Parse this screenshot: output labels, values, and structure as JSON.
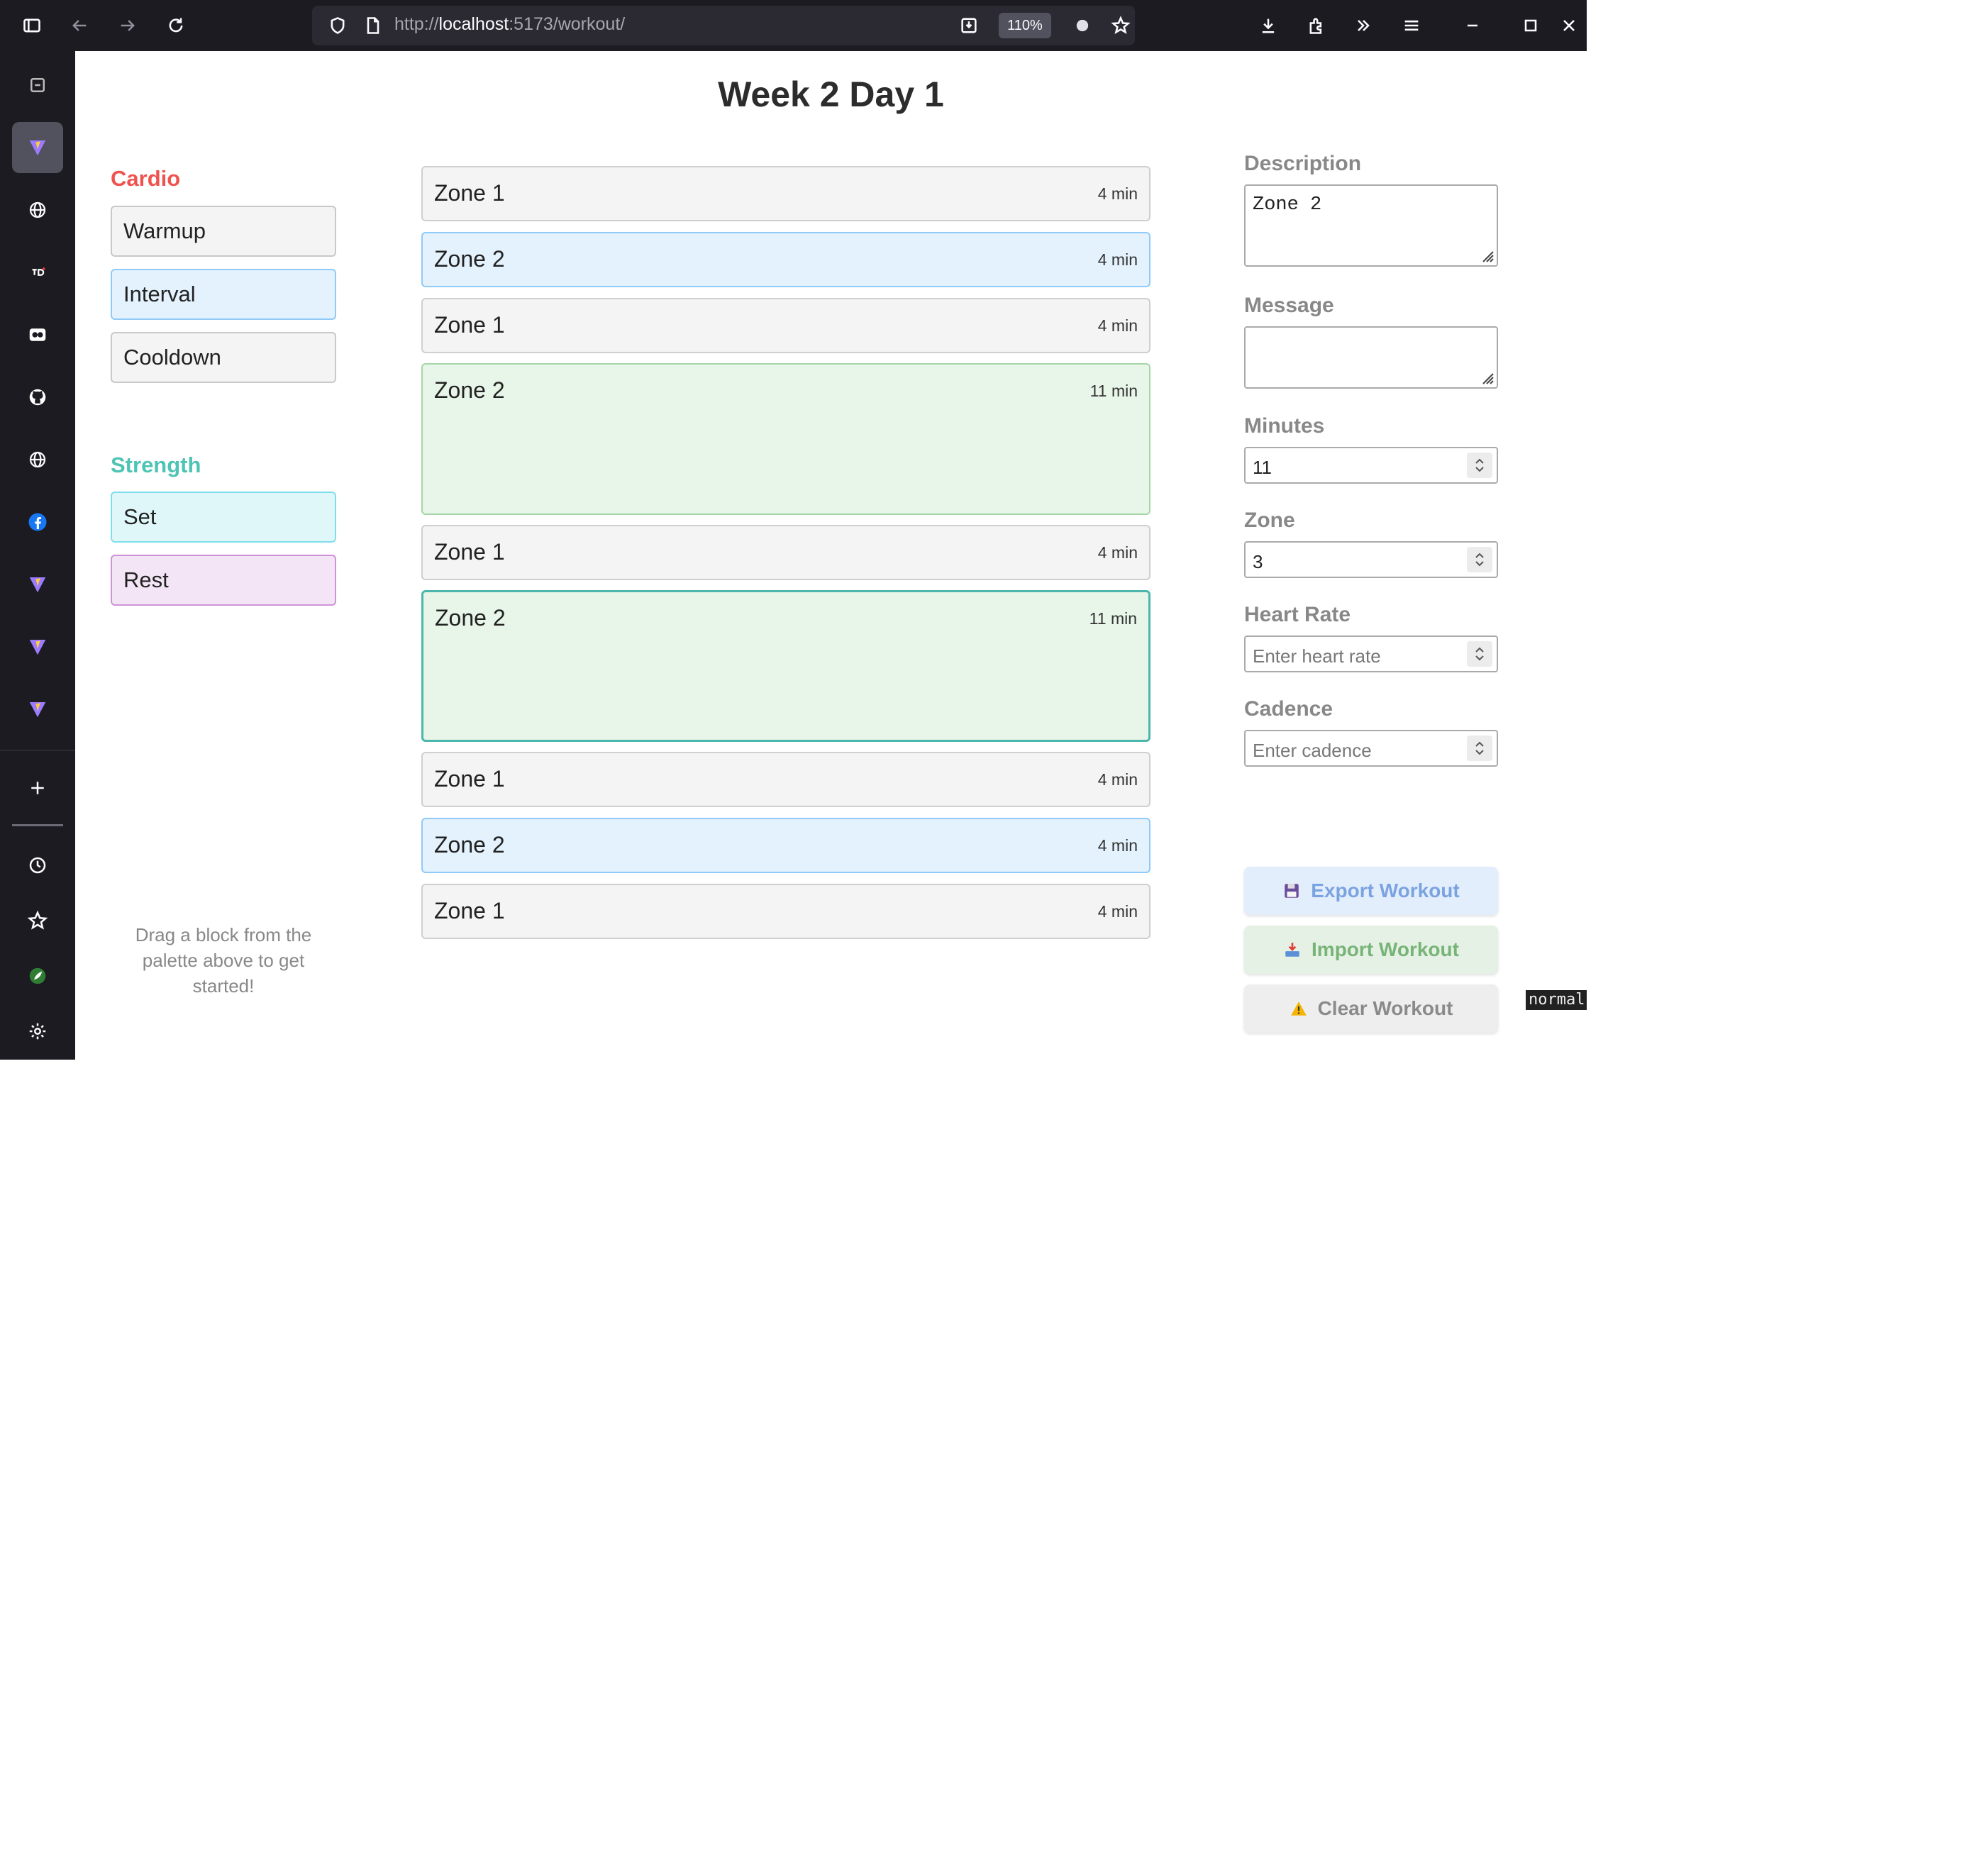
{
  "browser": {
    "url_prefix": "http://",
    "url_host": "localhost",
    "url_rest": ":5173/workout/",
    "zoom": "110%"
  },
  "page": {
    "title": "Week 2 Day 1",
    "hint": "Drag a block from the palette above to get started!"
  },
  "palette": {
    "cardio_title": "Cardio",
    "cardio_color": "#ef5350",
    "cardio_items": [
      "Warmup",
      "Interval",
      "Cooldown"
    ],
    "strength_title": "Strength",
    "strength_color": "#4dc4b4",
    "strength_items": [
      "Set",
      "Rest"
    ]
  },
  "workout": {
    "blocks": [
      {
        "label": "Zone 1",
        "duration": "4 min",
        "style": "gray"
      },
      {
        "label": "Zone 2",
        "duration": "4 min",
        "style": "blue"
      },
      {
        "label": "Zone 1",
        "duration": "4 min",
        "style": "gray"
      },
      {
        "label": "Zone 2",
        "duration": "11 min",
        "style": "green"
      },
      {
        "label": "Zone 1",
        "duration": "4 min",
        "style": "gray"
      },
      {
        "label": "Zone 2",
        "duration": "11 min",
        "style": "green",
        "selected": true
      },
      {
        "label": "Zone 1",
        "duration": "4 min",
        "style": "gray"
      },
      {
        "label": "Zone 2",
        "duration": "4 min",
        "style": "blue"
      },
      {
        "label": "Zone 1",
        "duration": "4 min",
        "style": "gray"
      }
    ]
  },
  "editor": {
    "description_label": "Description",
    "description_value": "Zone 2",
    "message_label": "Message",
    "message_value": "",
    "minutes_label": "Minutes",
    "minutes_value": "11",
    "zone_label": "Zone",
    "zone_value": "3",
    "heart_rate_label": "Heart Rate",
    "heart_rate_placeholder": "Enter heart rate",
    "cadence_label": "Cadence",
    "cadence_placeholder": "Enter cadence"
  },
  "actions": {
    "export_label": "Export Workout",
    "export_icon": "floppy-disk-icon",
    "import_label": "Import Workout",
    "import_icon": "inbox-tray-icon",
    "clear_label": "Clear Workout",
    "clear_icon": "warning-icon"
  },
  "status": {
    "mode": "normal"
  }
}
